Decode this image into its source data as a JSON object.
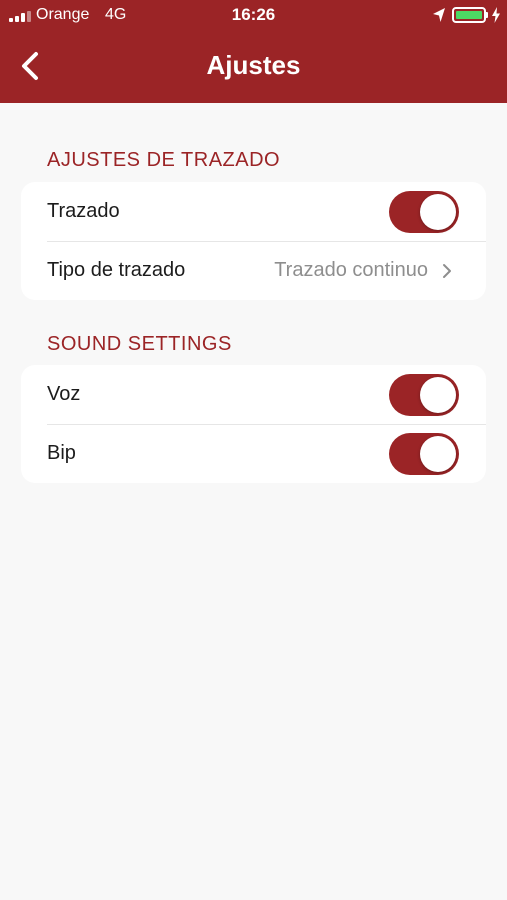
{
  "status_bar": {
    "carrier": "Orange",
    "network": "4G",
    "time": "16:26",
    "battery_color": "#4cd964"
  },
  "nav": {
    "title": "Ajustes",
    "back_icon": "chevron-left-icon"
  },
  "sections": [
    {
      "header": "AJUSTES DE TRAZADO",
      "rows": [
        {
          "label": "Trazado",
          "control": "toggle",
          "on": true
        },
        {
          "label": "Tipo de trazado",
          "control": "disclosure",
          "value": "Trazado continuo"
        }
      ]
    },
    {
      "header": "SOUND SETTINGS",
      "rows": [
        {
          "label": "Voz",
          "control": "toggle",
          "on": true
        },
        {
          "label": "Bip",
          "control": "toggle",
          "on": true
        }
      ]
    }
  ],
  "colors": {
    "accent": "#9b2426",
    "background": "#f8f8f8",
    "secondary_text": "#8e8e8e"
  }
}
